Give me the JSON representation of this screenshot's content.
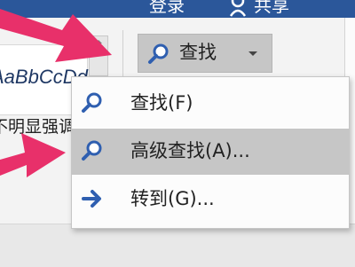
{
  "titlebar": {
    "login_label": "登录",
    "share_label": "共享"
  },
  "ribbon": {
    "style_sample": "AaBbCcDd",
    "style_name": "不明显强调",
    "find_button": {
      "label": "查找",
      "icon": "search-icon"
    }
  },
  "find_menu": {
    "items": [
      {
        "label": "查找(F)",
        "icon": "search-icon",
        "highlighted": false
      },
      {
        "label": "高级查找(A)...",
        "icon": "search-icon",
        "highlighted": true
      },
      {
        "label": "转到(G)...",
        "icon": "right-arrow-icon",
        "highlighted": false
      }
    ]
  },
  "colors": {
    "accent": "#2b579a",
    "highlight": "#c6c6c6",
    "annotation_arrow": "#e8306a",
    "icon_blue": "#2f5fb0"
  }
}
